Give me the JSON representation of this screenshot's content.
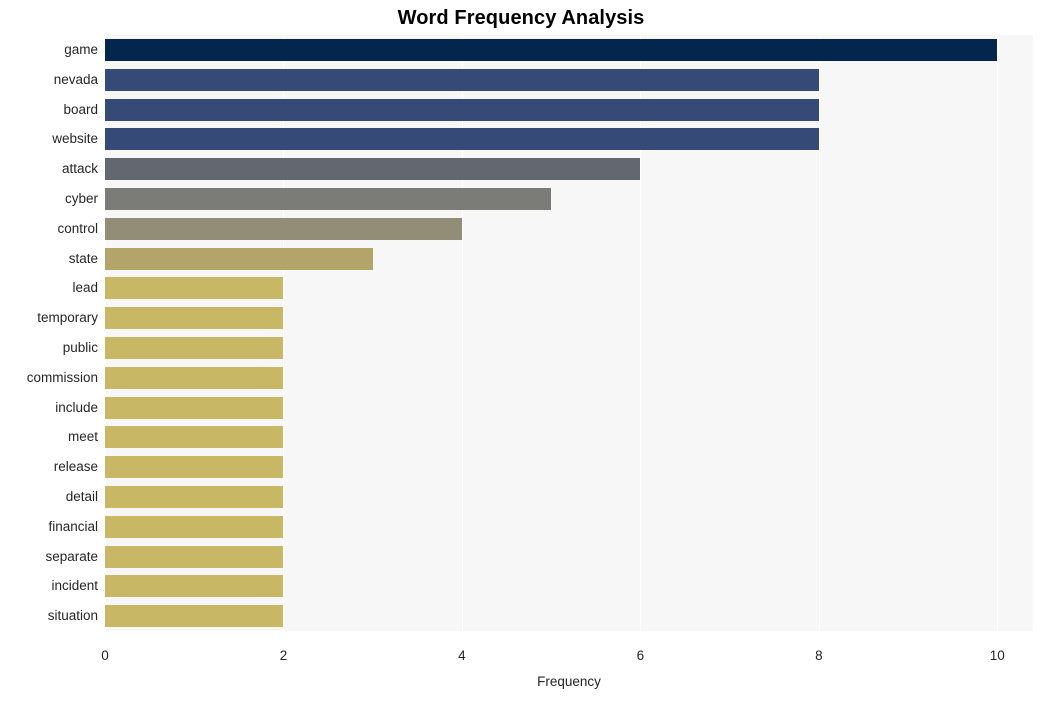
{
  "chart_data": {
    "type": "bar",
    "orientation": "horizontal",
    "title": "Word Frequency Analysis",
    "xlabel": "Frequency",
    "ylabel": "",
    "categories": [
      "game",
      "nevada",
      "board",
      "website",
      "attack",
      "cyber",
      "control",
      "state",
      "lead",
      "temporary",
      "public",
      "commission",
      "include",
      "meet",
      "release",
      "detail",
      "financial",
      "separate",
      "incident",
      "situation"
    ],
    "values": [
      10,
      8,
      8,
      8,
      6,
      5,
      4,
      3,
      2,
      2,
      2,
      2,
      2,
      2,
      2,
      2,
      2,
      2,
      2,
      2
    ],
    "bar_colors": [
      "#04254e",
      "#364a77",
      "#364a77",
      "#364a77",
      "#636770",
      "#7b7b78",
      "#918d77",
      "#b3a569",
      "#c8b765",
      "#c8b765",
      "#c8b765",
      "#c8b765",
      "#c8b765",
      "#c8b765",
      "#c8b765",
      "#c8b765",
      "#c8b765",
      "#c8b765",
      "#c8b765",
      "#c8b765"
    ],
    "xlim": [
      0,
      10.4
    ],
    "xticks": [
      0,
      2,
      4,
      6,
      8,
      10
    ],
    "xtick_labels": [
      "0",
      "2",
      "4",
      "6",
      "8",
      "10"
    ],
    "grid": true,
    "grid_color": "#ffffff",
    "plot_background": "#f7f7f7",
    "figure_background": "#ffffff",
    "legend": null
  }
}
